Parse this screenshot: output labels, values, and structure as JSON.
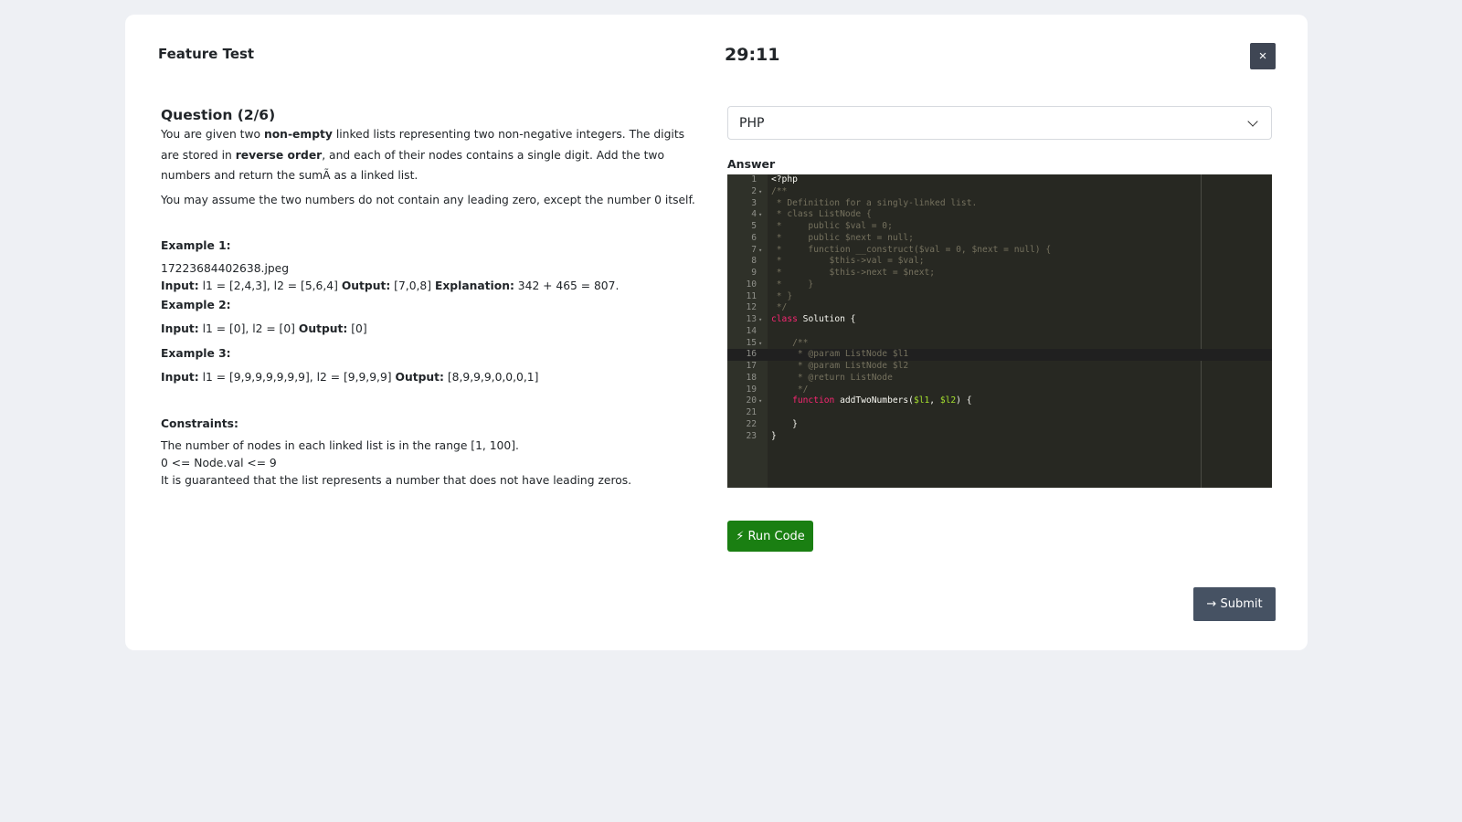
{
  "header": {
    "title": "Feature Test",
    "timer": "29:11",
    "close_label": "×"
  },
  "question": {
    "title": "Question (2/6)",
    "p1": [
      "You are given two ",
      "non-empty",
      " linked lists representing two non-negative integers. The digits are stored in ",
      "reverse order",
      ", and each of their nodes contains a single digit. Add the two numbers and return the sumÃ as a linked list."
    ],
    "p2": "You may assume the two numbers do not contain any leading zero, except the number 0 itself.",
    "example1": {
      "label": "Example 1:",
      "image": "17223684402638.jpeg",
      "input_label": "Input:",
      "input": " l1 = [2,4,3], l2 = [5,6,4] ",
      "output_label": "Output:",
      "output": " [7,0,8] ",
      "explanation_label": "Explanation:",
      "explanation": " 342 + 465 = 807."
    },
    "example2": {
      "label": "Example 2:",
      "input_label": "Input:",
      "input": " l1 = [0], l2 = [0] ",
      "output_label": "Output:",
      "output": " [0]"
    },
    "example3": {
      "label": "Example 3:",
      "input_label": "Input:",
      "input": " l1 = [9,9,9,9,9,9,9], l2 = [9,9,9,9] ",
      "output_label": "Output:",
      "output": " [8,9,9,9,0,0,0,1]"
    },
    "constraints": {
      "label": "Constraints:",
      "items": [
        "The number of nodes in each linked list is in the range [1, 100].",
        "0 <= Node.val <= 9",
        "It is guaranteed that the list represents a number that does not have leading zeros."
      ]
    }
  },
  "answer": {
    "language": "PHP",
    "label": "Answer",
    "lines": [
      [
        "1",
        "",
        "<?php",
        "p"
      ],
      [
        "2",
        "▾",
        "/**",
        "c"
      ],
      [
        "3",
        "",
        " * Definition for a singly-linked list.",
        "c"
      ],
      [
        "4",
        "▾",
        " * class ListNode {",
        "c"
      ],
      [
        "5",
        "",
        " *     public $val = 0;",
        "c"
      ],
      [
        "6",
        "",
        " *     public $next = null;",
        "c"
      ],
      [
        "7",
        "▾",
        " *     function __construct($val = 0, $next = null) {",
        "c"
      ],
      [
        "8",
        "",
        " *         $this->val = $val;",
        "c"
      ],
      [
        "9",
        "",
        " *         $this->next = $next;",
        "c"
      ],
      [
        "10",
        "",
        " *     }",
        "c"
      ],
      [
        "11",
        "",
        " * }",
        "c"
      ],
      [
        "12",
        "",
        " */",
        "c"
      ],
      [
        "13",
        "▾",
        "class| Solution {",
        "k"
      ],
      [
        "14",
        "",
        "",
        "p"
      ],
      [
        "15",
        "▾",
        "    /**",
        "c"
      ],
      [
        "16",
        "",
        " \t * @param ListNode $l1",
        "c"
      ],
      [
        "17",
        "",
        " \t * @param ListNode $l2",
        "c"
      ],
      [
        "18",
        "",
        " \t * @return ListNode",
        "c"
      ],
      [
        "19",
        "",
        " \t */",
        "c"
      ],
      [
        "20",
        "▾",
        "    function| addTwoNumbers(|$l1|, |$l2|) {",
        "f"
      ],
      [
        "21",
        "",
        "",
        "p"
      ],
      [
        "22",
        "",
        "    }",
        "p"
      ],
      [
        "23",
        "",
        "}",
        "p"
      ]
    ],
    "run_label": "Run Code",
    "submit_label": "Submit"
  }
}
